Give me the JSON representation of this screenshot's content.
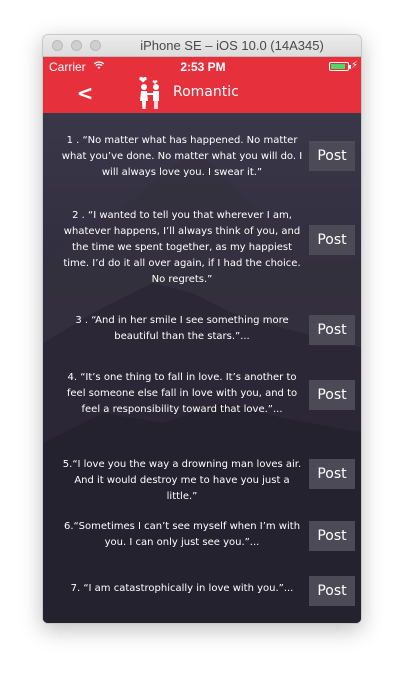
{
  "window": {
    "title": "iPhone SE – iOS 10.0 (14A345)"
  },
  "status_bar": {
    "carrier": "Carrier",
    "time": "2:53 PM",
    "battery_level": 0.9
  },
  "nav": {
    "back_label": "<",
    "title": "Romantic",
    "icon": "couple-icon"
  },
  "colors": {
    "nav_bg": "#e6303c",
    "content_bg": "#2e2b3c",
    "button_bg": "#4d4a57"
  },
  "quotes": [
    {
      "text": "1 . “No matter what has happened. No matter what you’ve done. No matter what you will do. I will always love you. I swear it.”",
      "button": "Post"
    },
    {
      "text": "2 . “I wanted to tell you that wherever I am, whatever happens, I’ll always think of you, and the time we spent together, as my happiest time. I’d do it all over again, if I had the choice. No regrets.”",
      "button": "Post"
    },
    {
      "text": "3 . “And in her smile I see something more beautiful than the stars.”...",
      "button": "Post"
    },
    {
      "text": "4. “It’s one thing to fall in love. It’s another to feel someone else fall in love with you, and to feel a responsibility toward that love.”...",
      "button": "Post"
    },
    {
      "text": "5.“I love you the way a drowning man loves air. And it would destroy me to have you just a little.”",
      "button": "Post"
    },
    {
      "text": "6.“Sometimes I can’t see myself when I’m with you. I can only just see you.”...",
      "button": "Post"
    },
    {
      "text": "7. “I am catastrophically in love with you.”...",
      "button": "Post"
    }
  ]
}
